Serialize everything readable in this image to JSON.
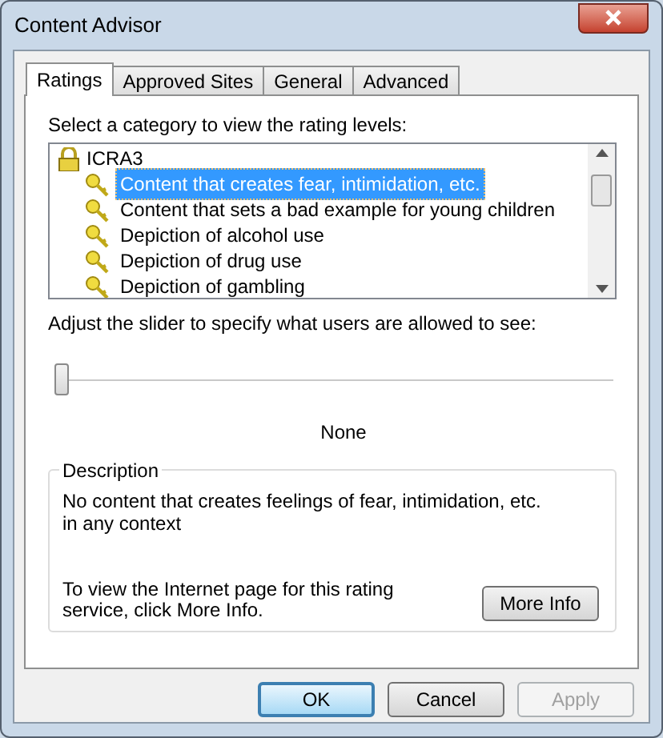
{
  "window": {
    "title": "Content Advisor"
  },
  "tabs": [
    {
      "label": "Ratings",
      "selected": true
    },
    {
      "label": "Approved Sites",
      "selected": false
    },
    {
      "label": "General",
      "selected": false
    },
    {
      "label": "Advanced",
      "selected": false
    }
  ],
  "category_prompt": "Select a category to view the rating levels:",
  "categories": {
    "label": "ICRA3",
    "children": [
      {
        "label": "Content that creates fear, intimidation, etc.",
        "selected": true
      },
      {
        "label": "Content that sets a bad example for young children",
        "selected": false
      },
      {
        "label": "Depiction of alcohol use",
        "selected": false
      },
      {
        "label": "Depiction of drug use",
        "selected": false
      },
      {
        "label": "Depiction of gambling",
        "selected": false
      }
    ]
  },
  "slider_prompt": "Adjust the slider to specify what users are allowed to see:",
  "slider": {
    "level": 0,
    "reading": "None"
  },
  "description": {
    "title": "Description",
    "text": "No content that creates feelings of fear, intimidation, etc. in any context",
    "info_text": "To view the Internet page for this rating service, click More Info.",
    "button": "More Info"
  },
  "buttons": [
    {
      "label": "OK",
      "disabled": false
    },
    {
      "label": "Cancel",
      "disabled": false
    },
    {
      "label": "Apply",
      "disabled": true
    }
  ]
}
